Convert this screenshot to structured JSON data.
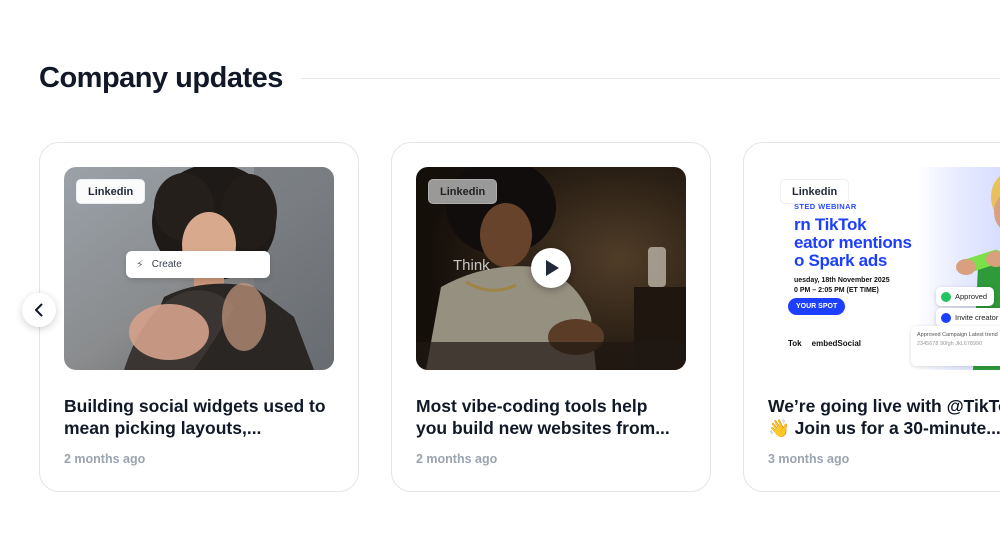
{
  "section": {
    "title": "Company updates"
  },
  "navigation": {
    "prev_icon": "chevron-left-icon"
  },
  "cards": [
    {
      "badge": "Linkedin",
      "overlay_label": "Create",
      "overlay_icon": "bolt-icon",
      "title_line1": "Building social widgets used to",
      "title_line2": "mean picking layouts,...",
      "time": "2 months ago"
    },
    {
      "badge": "Linkedin",
      "overlay_text": "Think",
      "play_icon": "play-icon",
      "title_line1": "Most vibe-coding tools help",
      "title_line2": "you build new websites from...",
      "time": "2 months ago"
    },
    {
      "badge": "Linkedin",
      "promo": {
        "tag": "STED WEBINAR",
        "headline_line1": "rn TikTok",
        "headline_line2": "eator mentions",
        "headline_line3": "o Spark ads",
        "date_line1": "uesday, 18th November 2025",
        "date_line2": "0 PM – 2:05 PM (ET TIME)",
        "cta": "YOUR SPOT",
        "brand1": "Tok",
        "brand2": "embedSocial",
        "approved_label": "Approved",
        "invite_label": "Invite creator",
        "table_header": "Approved    Campaign    Latest trend",
        "table_row": "2345678 90fgh JkL678990"
      },
      "title_line1": "We’re going live with @TikTok",
      "title_line2": "👋 Join us for a 30-minute...",
      "time": "3 months ago"
    }
  ],
  "colors": {
    "title_text": "#111827",
    "muted_text": "#9aa3af",
    "card_border": "#e2e5ea",
    "promo_blue": "#1d3fff"
  }
}
